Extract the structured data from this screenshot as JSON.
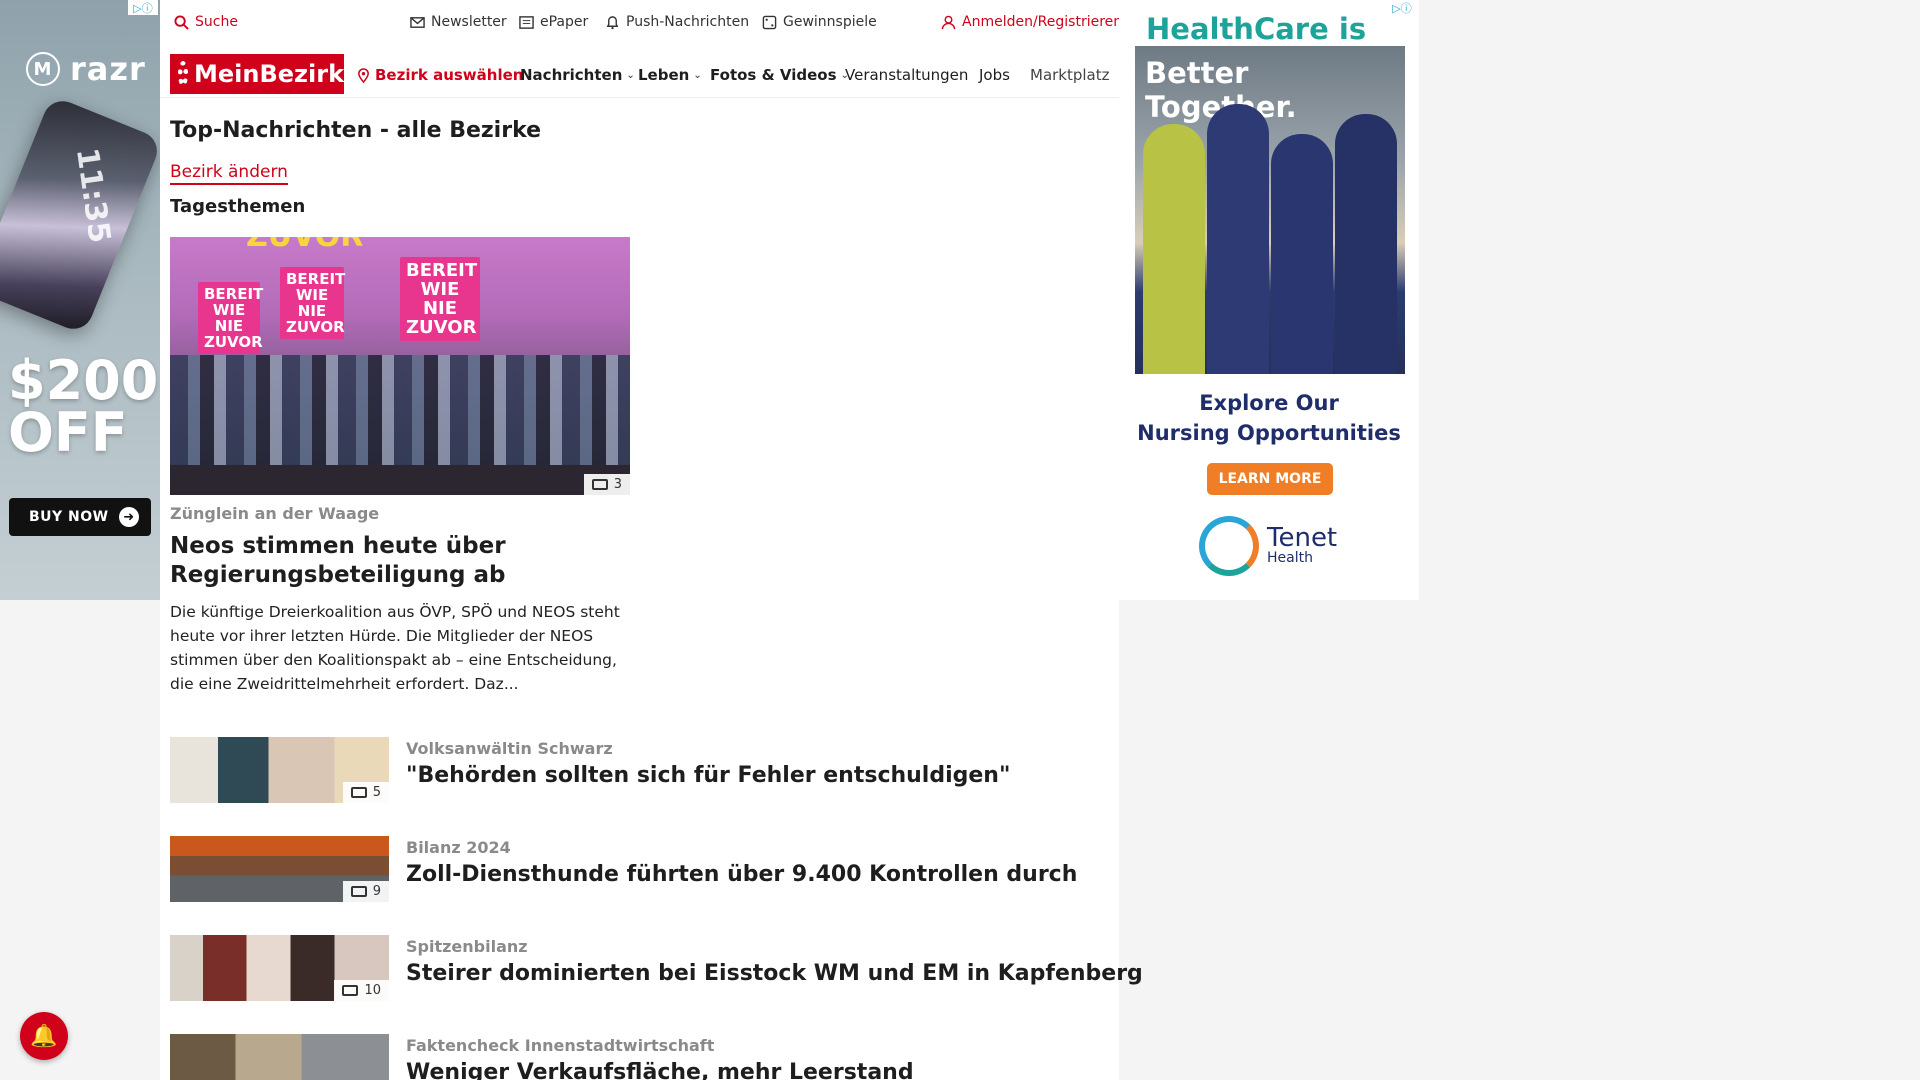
{
  "topbar": {
    "search": "Suche",
    "newsletter": "Newsletter",
    "epaper": "ePaper",
    "push": "Push-Nachrichten",
    "contests": "Gewinnspiele",
    "login": "Anmelden/Registrieren"
  },
  "nav": {
    "logo": "MeinBezirk",
    "select_district": "Bezirk auswählen",
    "items": [
      "Nachrichten",
      "Leben",
      "Fotos & Videos",
      "Veranstaltungen",
      "Jobs",
      "Marktplatz"
    ]
  },
  "page": {
    "title": "Top-Nachrichten - alle Bezirke",
    "change_district": "Bezirk ändern",
    "section": "Tagesthemen"
  },
  "hero": {
    "signs": [
      "BEREIT WIE NIE ZUVOR",
      "BEREIT WIE NIE ZUVOR",
      "BEREIT WIE NIE ZUVOR",
      "ZUVOR"
    ],
    "image_count": "3",
    "kicker": "Zünglein an der Waage",
    "headline": "Neos stimmen heute über Regierungsbeteiligung ab",
    "teaser": "Die künftige Dreierkoalition aus ÖVP, SPÖ und NEOS steht heute vor ihrer letzten Hürde. Die Mitglieder der NEOS stimmen über den Koalitionspakt ab – eine Entscheidung, die eine Zweidrittelmehrheit erfordert. Daz..."
  },
  "articles": [
    {
      "kicker": "Volksanwältin Schwarz",
      "headline": "\"Behörden sollten sich für Fehler entschuldigen\"",
      "count": "5"
    },
    {
      "kicker": "Bilanz 2024",
      "headline": "Zoll-Diensthunde führten über 9.400 Kontrollen durch",
      "count": "9"
    },
    {
      "kicker": "Spitzenbilanz",
      "headline": "Steirer dominierten bei Eisstock WM und EM in Kapfenberg",
      "count": "10"
    },
    {
      "kicker": "Faktencheck Innenstadtwirtschaft",
      "headline": "Weniger Verkaufsfläche, mehr Leerstand",
      "count": ""
    }
  ],
  "ad_left": {
    "brand": "razr",
    "clock": "11:35",
    "price_line1": "$200",
    "price_line2": "OFF",
    "cta": "BUY NOW"
  },
  "ad_right": {
    "title_line1": "HealthCare is",
    "title_line2": "Better Together.",
    "explore_line1": "Explore Our",
    "explore_line2": "Nursing Opportunities",
    "cta": "LEARN MORE",
    "brand": "Tenet",
    "brand_sub": "Health"
  },
  "colors": {
    "brand_red": "#d0021b",
    "healthcare_teal": "#1da39a",
    "tenet_navy": "#1f2d6b",
    "cta_orange": "#f07e26"
  }
}
